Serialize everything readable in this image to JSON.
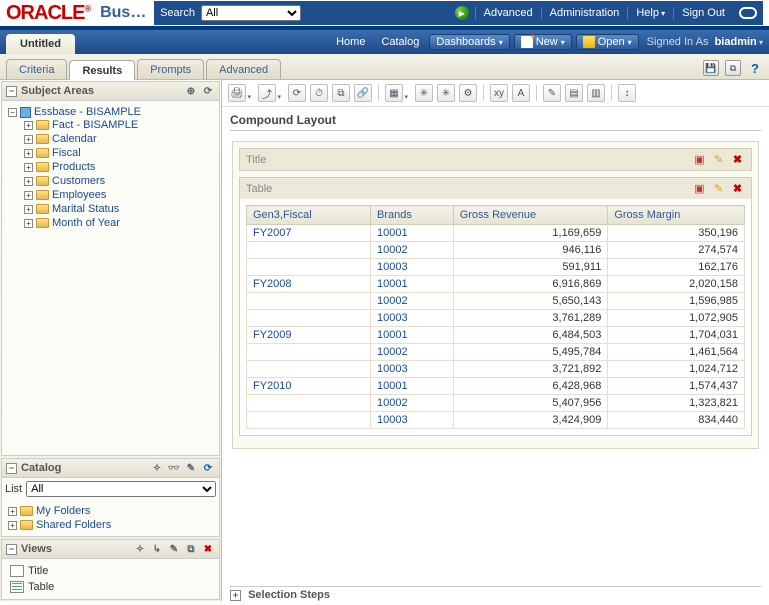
{
  "brand": {
    "logo": "ORACLE",
    "app_title": "Business Intelligence"
  },
  "search": {
    "label": "Search",
    "selected": "All",
    "go_aria": "Run search"
  },
  "toplinks": {
    "advanced": "Advanced",
    "administration": "Administration",
    "help": "Help",
    "signout": "Sign Out"
  },
  "globalnav": {
    "doc_title": "Untitled",
    "home": "Home",
    "catalog": "Catalog",
    "dashboards": "Dashboards",
    "new": "New",
    "open": "Open",
    "signed_prefix": "Signed In As",
    "signed_user": "biadmin"
  },
  "subtabs": {
    "criteria": "Criteria",
    "results": "Results",
    "prompts": "Prompts",
    "advanced": "Advanced"
  },
  "panels": {
    "subject": {
      "title": "Subject Areas",
      "root": "Essbase - BISAMPLE",
      "items": [
        "Fact - BISAMPLE",
        "Calendar",
        "Fiscal",
        "Products",
        "Customers",
        "Employees",
        "Marital Status",
        "Month of Year"
      ]
    },
    "catalog": {
      "title": "Catalog",
      "list_label": "List",
      "list_value": "All",
      "folders": [
        "My Folders",
        "Shared Folders"
      ]
    },
    "views": {
      "title": "Views",
      "items": [
        "Title",
        "Table"
      ]
    }
  },
  "results": {
    "compound_header": "Compound Layout",
    "blocks": {
      "title": "Title",
      "table": "Table"
    },
    "columns": [
      "Gen3,Fiscal",
      "Brands",
      "Gross Revenue",
      "Gross Margin"
    ],
    "rows": [
      {
        "fiscal": "FY2007",
        "brand": "10001",
        "rev": "1,169,659",
        "margin": "350,196"
      },
      {
        "fiscal": "",
        "brand": "10002",
        "rev": "946,116",
        "margin": "274,574"
      },
      {
        "fiscal": "",
        "brand": "10003",
        "rev": "591,911",
        "margin": "162,176"
      },
      {
        "fiscal": "FY2008",
        "brand": "10001",
        "rev": "6,916,869",
        "margin": "2,020,158"
      },
      {
        "fiscal": "",
        "brand": "10002",
        "rev": "5,650,143",
        "margin": "1,596,985"
      },
      {
        "fiscal": "",
        "brand": "10003",
        "rev": "3,761,289",
        "margin": "1,072,905"
      },
      {
        "fiscal": "FY2009",
        "brand": "10001",
        "rev": "6,484,503",
        "margin": "1,704,031"
      },
      {
        "fiscal": "",
        "brand": "10002",
        "rev": "5,495,784",
        "margin": "1,461,564"
      },
      {
        "fiscal": "",
        "brand": "10003",
        "rev": "3,721,892",
        "margin": "1,024,712"
      },
      {
        "fiscal": "FY2010",
        "brand": "10001",
        "rev": "6,428,968",
        "margin": "1,574,437"
      },
      {
        "fiscal": "",
        "brand": "10002",
        "rev": "5,407,956",
        "margin": "1,323,821"
      },
      {
        "fiscal": "",
        "brand": "10003",
        "rev": "3,424,909",
        "margin": "834,440"
      }
    ],
    "selection_steps": "Selection Steps"
  }
}
